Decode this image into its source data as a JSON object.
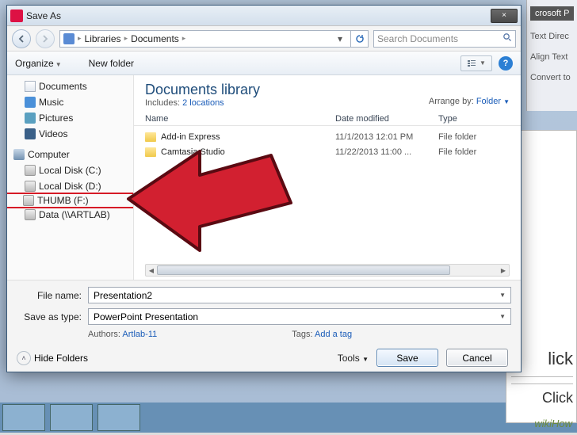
{
  "background": {
    "app_title": "crosoft P",
    "menu1": "Text Direc",
    "menu2": "Align Text",
    "menu3": "Convert to",
    "doc_text1": "lick",
    "doc_text2": "Click",
    "watermark": "wikiHow"
  },
  "dialog": {
    "title": "Save As",
    "close_label": "×",
    "breadcrumbs": [
      "Libraries",
      "Documents"
    ],
    "search_placeholder": "Search Documents",
    "toolbar": {
      "organize": "Organize",
      "new_folder": "New folder"
    },
    "tree": {
      "libraries": [
        {
          "label": "Documents",
          "icon": "doc"
        },
        {
          "label": "Music",
          "icon": "music"
        },
        {
          "label": "Pictures",
          "icon": "pic"
        },
        {
          "label": "Videos",
          "icon": "vid"
        }
      ],
      "computer_label": "Computer",
      "drives": [
        {
          "label": "Local Disk (C:)",
          "icon": "drive"
        },
        {
          "label": "Local Disk (D:)",
          "icon": "drive"
        },
        {
          "label": "THUMB (F:)",
          "icon": "drive",
          "highlight": true
        },
        {
          "label": "Data (\\\\ARTLAB)",
          "icon": "drive"
        }
      ]
    },
    "library": {
      "title": "Documents library",
      "includes_label": "Includes:",
      "locations": "2 locations",
      "arrange_label": "Arrange by:",
      "arrange_value": "Folder",
      "cols": {
        "c1": "Name",
        "c2": "Date modified",
        "c3": "Type"
      },
      "rows": [
        {
          "name": "Add-in Express",
          "date": "11/1/2013 12:01 PM",
          "type": "File folder"
        },
        {
          "name": "Camtasia Studio",
          "date": "11/22/2013 11:00 ...",
          "type": "File folder"
        }
      ]
    },
    "form": {
      "file_name_label": "File name:",
      "file_name_value": "Presentation2",
      "save_type_label": "Save as type:",
      "save_type_value": "PowerPoint Presentation",
      "authors_label": "Authors:",
      "authors_value": "Artlab-11",
      "tags_label": "Tags:",
      "tags_value": "Add a tag"
    },
    "footer": {
      "hide_folders": "Hide Folders",
      "tools": "Tools",
      "save": "Save",
      "cancel": "Cancel"
    }
  }
}
